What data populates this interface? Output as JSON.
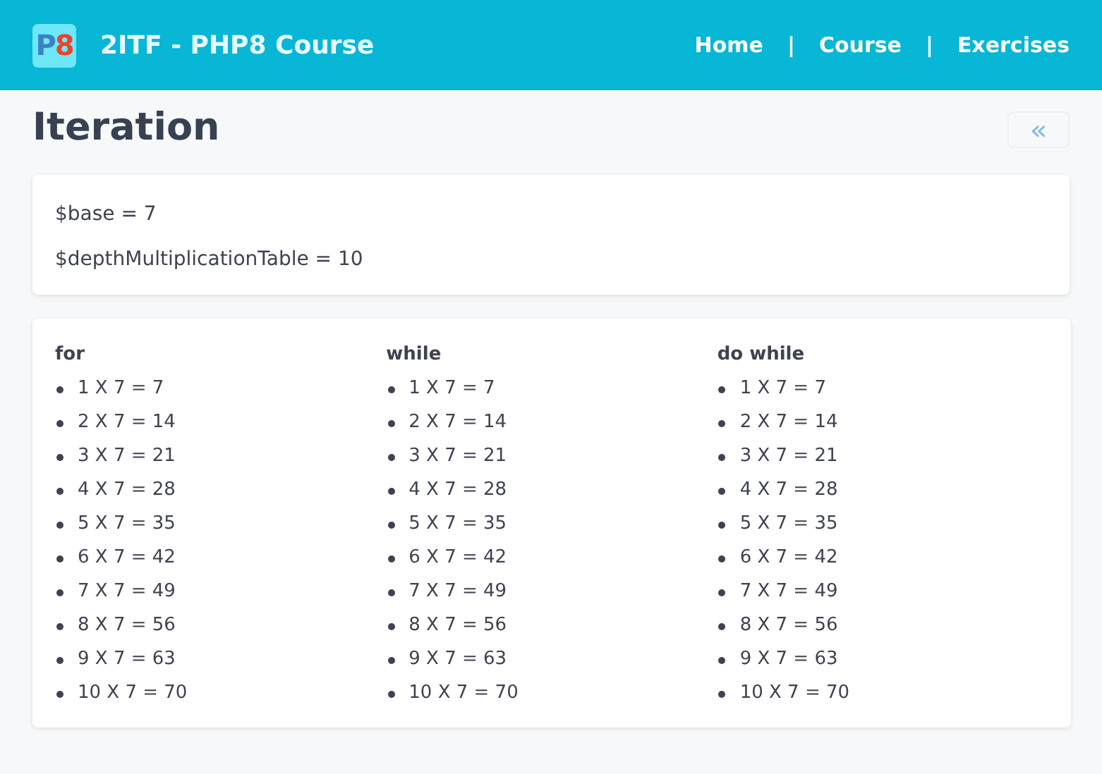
{
  "header": {
    "logo": [
      {
        "text": "P",
        "color": "#3b82c4"
      },
      {
        "text": "8",
        "color": "#e8452c"
      }
    ],
    "title": "2ITF - PHP8 Course",
    "nav": [
      "Home",
      "Course",
      "Exercises"
    ],
    "separator": "|"
  },
  "page": {
    "title": "Iteration",
    "back_button": {
      "label": "«"
    }
  },
  "variables": [
    "$base = 7",
    "$depthMultiplicationTable = 10"
  ],
  "columns": [
    {
      "heading": "for",
      "items": [
        "1 X 7 = 7",
        "2 X 7 = 14",
        "3 X 7 = 21",
        "4 X 7 = 28",
        "5 X 7 = 35",
        "6 X 7 = 42",
        "7 X 7 = 49",
        "8 X 7 = 56",
        "9 X 7 = 63",
        "10 X 7 = 70"
      ]
    },
    {
      "heading": "while",
      "items": [
        "1 X 7 = 7",
        "2 X 7 = 14",
        "3 X 7 = 21",
        "4 X 7 = 28",
        "5 X 7 = 35",
        "6 X 7 = 42",
        "7 X 7 = 49",
        "8 X 7 = 56",
        "9 X 7 = 63",
        "10 X 7 = 70"
      ]
    },
    {
      "heading": "do while",
      "items": [
        "1 X 7 = 7",
        "2 X 7 = 14",
        "3 X 7 = 21",
        "4 X 7 = 28",
        "5 X 7 = 35",
        "6 X 7 = 42",
        "7 X 7 = 49",
        "8 X 7 = 56",
        "9 X 7 = 63",
        "10 X 7 = 70"
      ]
    }
  ]
}
